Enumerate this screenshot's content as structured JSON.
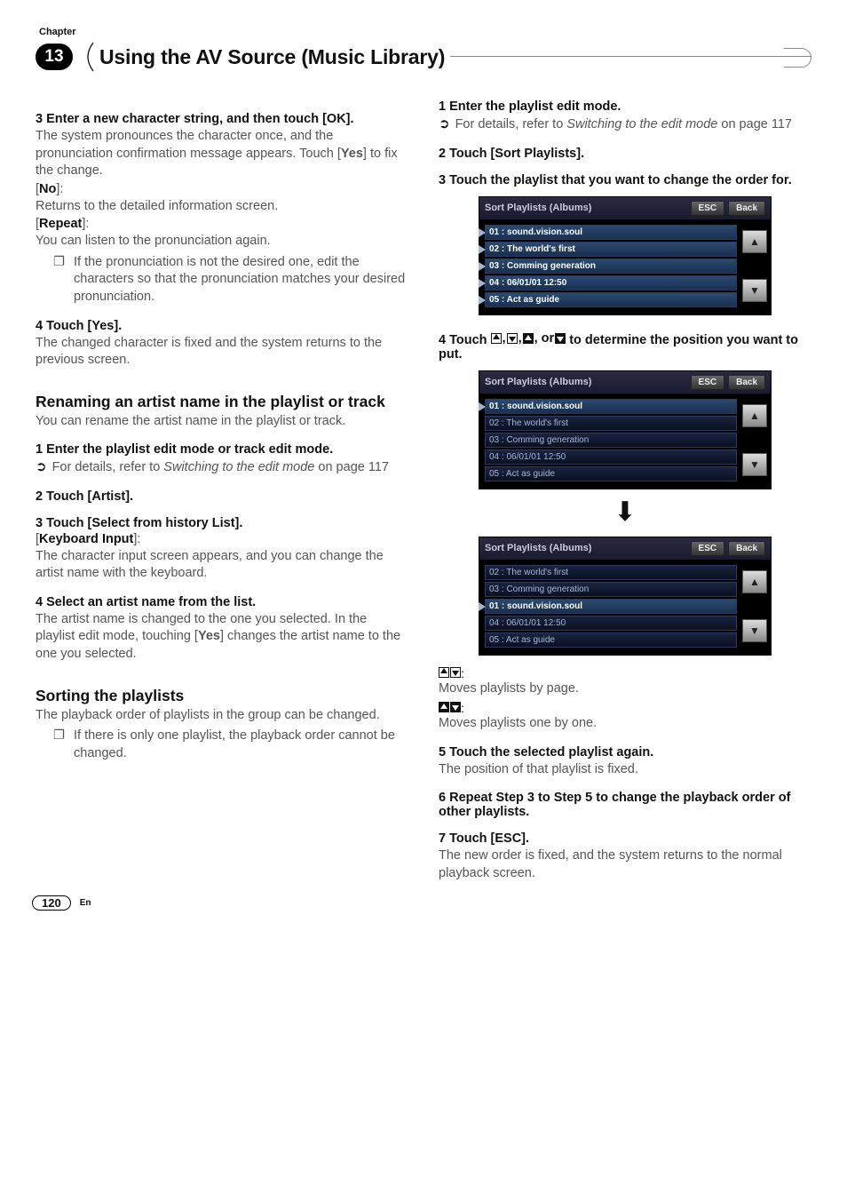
{
  "chapter": {
    "label": "Chapter",
    "number": "13"
  },
  "page_title": "Using the AV Source (Music Library)",
  "left": {
    "s3_title": "3   Enter a new character string, and then touch [OK].",
    "s3_body": "The system pronounces the character once, and the pronunciation confirmation message appears. Touch [Yes] to fix the change.",
    "opt_no_label": "No",
    "opt_no_body": "Returns to the detailed information screen.",
    "opt_repeat_label": "Repeat",
    "opt_repeat_body": "You can listen to the pronunciation again.",
    "s3_note": "If the pronunciation is not the desired one, edit the characters so that the pronunciation matches your desired pronunciation.",
    "s4_title": "4   Touch [Yes].",
    "s4_body": "The changed character is fixed and the system returns to the previous screen.",
    "h_rename": "Renaming an artist name in the playlist or track",
    "rename_intro": "You can rename the artist name in the playlist or track.",
    "r1_title": "1   Enter the playlist edit mode or track edit mode.",
    "ref_text": "For details, refer to ",
    "ref_link": "Switching to the edit mode",
    "ref_page": " on page 117",
    "r2_title": "2   Touch [Artist].",
    "r3_title": "3   Touch [Select from history List].",
    "r3_option_label": "Keyboard Input",
    "r3_option_body": "The character input screen appears, and you can change the artist name with the keyboard.",
    "r4_title": "4   Select an artist name from the list.",
    "r4_body": "The artist name is changed to the one you selected. In the playlist edit mode, touching [Yes] changes the artist name to the one you selected.",
    "h_sort": "Sorting the playlists",
    "sort_intro": "The playback order of playlists in the group can be changed.",
    "sort_note": "If there is only one playlist, the playback order cannot be changed."
  },
  "right": {
    "s1_title": "1   Enter the playlist edit mode.",
    "s2_title": "2   Touch [Sort Playlists].",
    "s3_title": "3   Touch the playlist that you want to change the order for.",
    "s4_title_prefix": "4   Touch ",
    "s4_title_suffix": " to determine the position you want to put.",
    "icon_legend_page": "Moves playlists by page.",
    "icon_legend_one": "Moves playlists one by one.",
    "s5_title": "5   Touch the selected playlist again.",
    "s5_body": "The position of that playlist is fixed.",
    "s6_title": "6   Repeat Step 3 to Step 5 to change the playback order of other playlists.",
    "s7_title": "7   Touch [ESC].",
    "s7_body": "The new order is fixed, and the system returns to the normal playback screen."
  },
  "screenshots": {
    "header_title": "Sort Playlists (Albums)",
    "esc": "ESC",
    "back": "Back",
    "listA": [
      "01 : sound.vision.soul",
      "02 : The world's first",
      "03 : Comming generation",
      "04 : 06/01/01 12:50",
      "05 : Act as guide"
    ],
    "listB_selected": "01 : sound.vision.soul",
    "listB": [
      "01 : sound.vision.soul",
      "02 : The world's first",
      "03 : Comming generation",
      "04 : 06/01/01 12:50",
      "05 : Act as guide"
    ],
    "listC": [
      "02 : The world's first",
      "03 : Comming generation",
      "01 : sound.vision.soul",
      "04 : 06/01/01 12:50",
      "05 : Act as guide"
    ]
  },
  "footer": {
    "page": "120",
    "lang": "En"
  }
}
